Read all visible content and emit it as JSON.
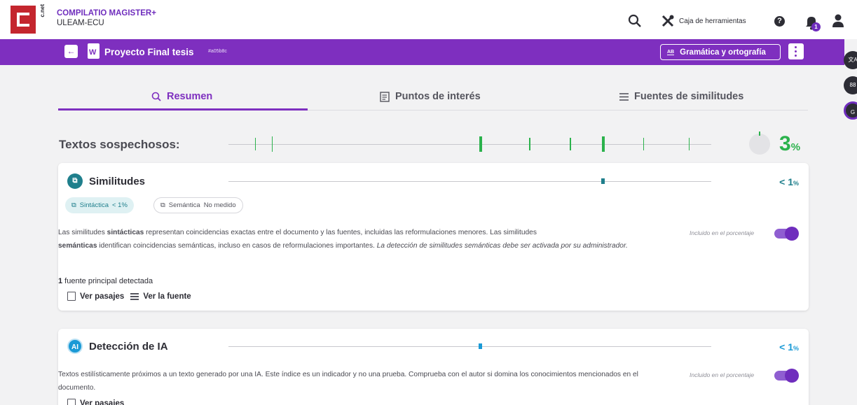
{
  "app": {
    "logo_side_text": "c.net",
    "name": "COMPILATIO MAGISTER+",
    "org": "ULEAM-ECU"
  },
  "topbar": {
    "toolbox_label": "Caja de herramientas",
    "help_glyph": "?",
    "notification_count": "1",
    "icons": [
      "search-icon",
      "tools-icon",
      "help-icon",
      "bell-icon",
      "user-icon"
    ]
  },
  "document": {
    "back_glyph": "←",
    "file_glyph": "W",
    "title": "Proyecto Final tesis",
    "id": "#a05b8c",
    "grammar_icon_text": "AB",
    "grammar_button": "Gramática y ortografía"
  },
  "side_floats": [
    "文A",
    "88",
    "G"
  ],
  "tabs": [
    {
      "label": "Resumen",
      "icon": "search-doc-icon",
      "active": true
    },
    {
      "label": "Puntos de interés",
      "icon": "doc-icon",
      "active": false
    },
    {
      "label": "Fuentes de similitudes",
      "icon": "list-icon",
      "active": false
    }
  ],
  "suspicious": {
    "label": "Textos sospechosos:",
    "percent": "3",
    "percent_sign": "%",
    "accent": "#2bb24c"
  },
  "similitudes": {
    "icon_text": "⧉",
    "title": "Similitudes",
    "percent": "< 1",
    "percent_sign": "%",
    "color": "#1f7f8c",
    "chip_on_label": "Sintáctica",
    "chip_on_value": "< 1%",
    "chip_off_label": "Semántica",
    "chip_off_value": "No medido",
    "desc_1": "Las similitudes ",
    "desc_2": "sintácticas",
    "desc_3": " representan coincidencias exactas entre el documento y las fuentes, incluidas las reformulaciones menores. Las similitudes",
    "desc_4": "semánticas",
    "desc_5": " identifican coincidencias semánticas, incluso en casos de reformulaciones importantes. ",
    "desc_6": "La detección de similitudes semánticas debe ser activada por su administrador.",
    "included_label": "Incluido en el porcentaje",
    "source_count": "1",
    "source_text": " fuente principal detectada",
    "link_passages": "Ver pasajes",
    "link_source": "Ver la fuente"
  },
  "ia": {
    "icon_text": "AI",
    "title": "Detección de IA",
    "percent": "< 1",
    "percent_sign": "%",
    "color": "#1a9ad6",
    "desc": "Textos estilísticamente próximos a un texto generado por una IA. Este índice es un indicador y no una prueba. Comprueba con el autor si domina los conocimientos mencionados en el documento.",
    "included_label": "Incluido en el porcentaje",
    "link_passages": "Ver pasajes"
  }
}
